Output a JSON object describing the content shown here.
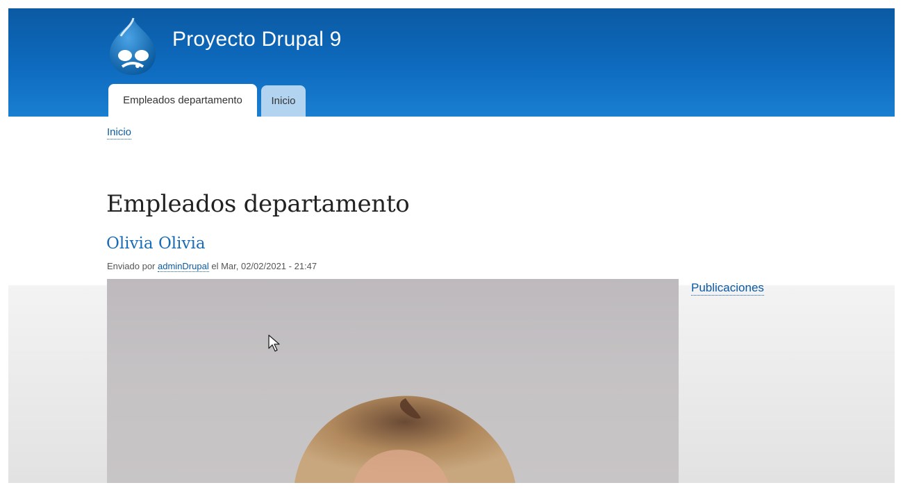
{
  "header": {
    "site_name": "Proyecto Drupal 9",
    "logo_icon": "drupal-drop-logo",
    "bg_color": "#0e6bbf"
  },
  "tabs": [
    {
      "label": "Empleados departamento",
      "active": true
    },
    {
      "label": "Inicio",
      "active": false
    }
  ],
  "breadcrumb": {
    "label": "Inicio"
  },
  "main": {
    "page_title": "Empleados departamento",
    "node": {
      "title": "Olivia Olivia",
      "submitted_prefix": "Enviado por",
      "author": "adminDrupal",
      "submitted_suffix": "el Mar, 02/02/2021 - 21:47"
    }
  },
  "sidebar": {
    "link_label": "Publicaciones"
  },
  "colors": {
    "link": "#0b5aa3",
    "node_title": "#1a6bb5"
  }
}
